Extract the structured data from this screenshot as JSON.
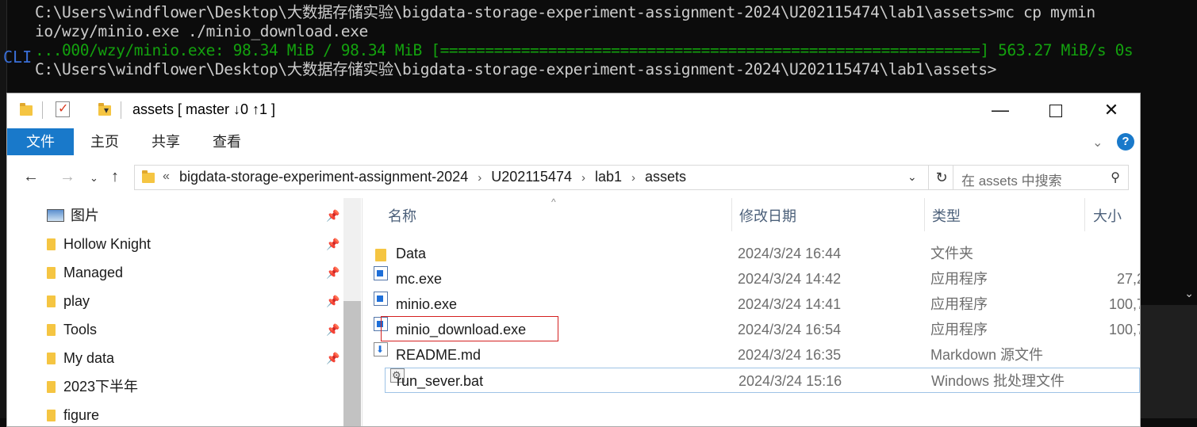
{
  "terminal": {
    "side_label": "CLI",
    "lines": [
      "C:\\Users\\windflower\\Desktop\\大数据存储实验\\bigdata-storage-experiment-assignment-2024\\U202115474\\lab1\\assets>mc cp mymin",
      "io/wzy/minio.exe ./minio_download.exe",
      "...000/wzy/minio.exe: 98.34 MiB / 98.34 MiB [============================================================] 563.27 MiB/s 0s",
      "C:\\Users\\windflower\\Desktop\\大数据存储实验\\bigdata-storage-experiment-assignment-2024\\U202115474\\lab1\\assets>"
    ]
  },
  "explorer": {
    "title": "assets [ master ↓0 ↑1 ]",
    "window_buttons": {
      "minimize": "—",
      "close": "✕"
    },
    "ribbon_tabs": [
      "文件",
      "主页",
      "共享",
      "查看"
    ],
    "help": "?",
    "address": {
      "overflow": "«",
      "crumbs": [
        "bigdata-storage-experiment-assignment-2024",
        "U202115474",
        "lab1",
        "assets"
      ]
    },
    "search_placeholder": "在 assets 中搜索",
    "nav_items": [
      {
        "label": "图片",
        "icon": "picture-icon",
        "pinned": true
      },
      {
        "label": "Hollow Knight",
        "icon": "folder-icon",
        "pinned": true
      },
      {
        "label": "Managed",
        "icon": "folder-icon",
        "pinned": true
      },
      {
        "label": "play",
        "icon": "folder-icon",
        "pinned": true
      },
      {
        "label": "Tools",
        "icon": "folder-icon",
        "pinned": true
      },
      {
        "label": "My data",
        "icon": "folder-icon",
        "pinned": true
      },
      {
        "label": "2023下半年",
        "icon": "folder-icon",
        "pinned": false
      },
      {
        "label": "figure",
        "icon": "folder-icon",
        "pinned": false
      }
    ],
    "columns": [
      "名称",
      "修改日期",
      "类型",
      "大小"
    ],
    "files": [
      {
        "name": "Data",
        "date": "2024/3/24 16:44",
        "type": "文件夹",
        "size": "",
        "icon": "folder-icon"
      },
      {
        "name": "mc.exe",
        "date": "2024/3/24 14:42",
        "type": "应用程序",
        "size": "27,2",
        "icon": "exe-icon"
      },
      {
        "name": "minio.exe",
        "date": "2024/3/24 14:41",
        "type": "应用程序",
        "size": "100,7",
        "icon": "exe-icon"
      },
      {
        "name": "minio_download.exe",
        "date": "2024/3/24 16:54",
        "type": "应用程序",
        "size": "100,7",
        "icon": "exe-icon"
      },
      {
        "name": "README.md",
        "date": "2024/3/24 16:35",
        "type": "Markdown 源文件",
        "size": "",
        "icon": "markdown-icon"
      },
      {
        "name": "run_sever.bat",
        "date": "2024/3/24 15:16",
        "type": "Windows 批处理文件",
        "size": "",
        "icon": "batch-file-icon"
      }
    ],
    "highlight_color": "#d42020",
    "accent_color": "#1979ca"
  }
}
